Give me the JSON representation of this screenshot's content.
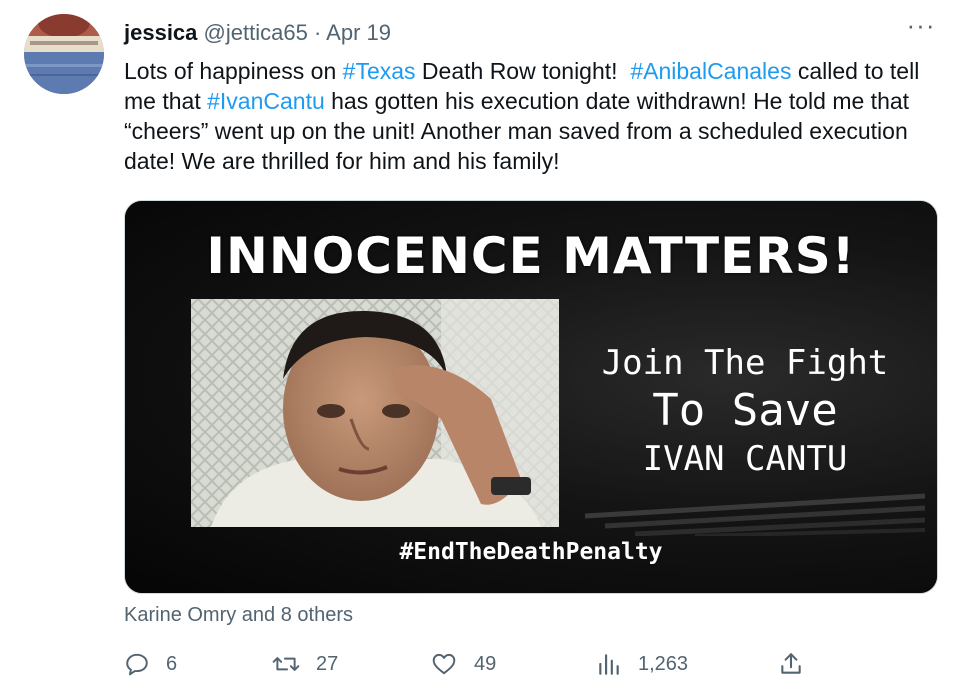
{
  "tweet": {
    "author_name": "jessica",
    "handle": "@jettica65",
    "separator": "·",
    "date": "Apr 19",
    "more_label": "···",
    "text_parts": [
      "Lots of happiness on ",
      "#Texas",
      " Death Row tonight!  ",
      "#AnibalCanales",
      " called to tell me that ",
      "#IvanCantu",
      " has gotten his execution date withdrawn! He told me that “cheers” went up on the unit! Another man saved from a scheduled execution date! We are thrilled for him and his family!"
    ],
    "liked_by": "Karine Omry and 8 others"
  },
  "media": {
    "headline": "INNOCENCE MATTERS!",
    "join_line1": "Join The Fight",
    "join_line2": "To Save",
    "join_line3": "IVAN CANTU",
    "hashtag": "#EndTheDeathPenalty"
  },
  "actions": {
    "reply": {
      "icon": "reply-icon",
      "count": "6"
    },
    "retweet": {
      "icon": "retweet-icon",
      "count": "27"
    },
    "like": {
      "icon": "heart-icon",
      "count": "49"
    },
    "views": {
      "icon": "views-icon",
      "count": "1,263"
    },
    "share": {
      "icon": "share-icon"
    }
  },
  "colors": {
    "link": "#1d9bf0",
    "secondary_text": "#536471",
    "primary_text": "#0f1419"
  }
}
